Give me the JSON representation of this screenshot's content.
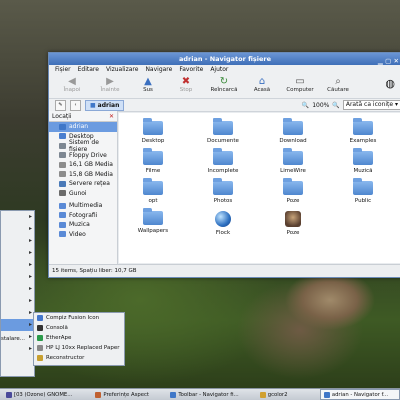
{
  "window": {
    "title": "adrian - Navigator fișiere",
    "menubar": [
      "Fișier",
      "Editare",
      "Vizualizare",
      "Navigare",
      "Favorite",
      "Ajutor"
    ],
    "toolbar": [
      {
        "label": "Înapoi",
        "icon": "back-arrow-icon",
        "enabled": false
      },
      {
        "label": "Înainte",
        "icon": "forward-arrow-icon",
        "enabled": false
      },
      {
        "label": "Sus",
        "icon": "up-arrow-icon",
        "enabled": true
      },
      {
        "label": "Stop",
        "icon": "stop-icon",
        "enabled": false
      },
      {
        "label": "Reîncarcă",
        "icon": "reload-icon",
        "enabled": true
      },
      {
        "label": "Acasă",
        "icon": "home-icon",
        "enabled": true
      },
      {
        "label": "Computer",
        "icon": "computer-icon",
        "enabled": true
      },
      {
        "label": "Căutare",
        "icon": "search-icon",
        "enabled": true
      }
    ],
    "location": {
      "crumb": "adrian",
      "zoom": "100%",
      "view": "Arată ca iconițe"
    },
    "sidebar": {
      "header": "Locații",
      "items": [
        {
          "label": "adrian",
          "color": "#3f77c8",
          "selected": true
        },
        {
          "label": "Desktop",
          "color": "#4b7fcf"
        },
        {
          "label": "Sistem de fișiere",
          "color": "#7d8792"
        },
        {
          "label": "Floppy Drive",
          "color": "#7d8792"
        },
        {
          "label": "16,1 GB Media",
          "color": "#8c8c8c"
        },
        {
          "label": "15,8 GB Media",
          "color": "#8c8c8c"
        },
        {
          "label": "Servere rețea",
          "color": "#4a7ab8"
        },
        {
          "label": "Gunoi",
          "color": "#6b6b6b"
        },
        {
          "label": "Multimedia",
          "color": "#5a8ad6"
        },
        {
          "label": "Fotografii",
          "color": "#5a8ad6"
        },
        {
          "label": "Muzica",
          "color": "#5a8ad6"
        },
        {
          "label": "Video",
          "color": "#5a8ad6"
        }
      ]
    },
    "files": [
      {
        "label": "Desktop",
        "kind": "folder"
      },
      {
        "label": "Documente",
        "kind": "folder"
      },
      {
        "label": "Download",
        "kind": "folder"
      },
      {
        "label": "Examples",
        "kind": "folder"
      },
      {
        "label": "Filme",
        "kind": "folder"
      },
      {
        "label": "Incomplete",
        "kind": "folder"
      },
      {
        "label": "LimeWire",
        "kind": "folder"
      },
      {
        "label": "Muzică",
        "kind": "folder"
      },
      {
        "label": "opt",
        "kind": "folder"
      },
      {
        "label": "Photos",
        "kind": "folder"
      },
      {
        "label": "Poze",
        "kind": "folder"
      },
      {
        "label": "Public",
        "kind": "folder"
      },
      {
        "label": "Wallpapers",
        "kind": "folder"
      },
      {
        "label": "Flock",
        "kind": "globe"
      },
      {
        "label": "Poze",
        "kind": "photo"
      }
    ],
    "status": "15 items, Spațiu liber: 10,7 GB"
  },
  "menu": {
    "label": "stalare...",
    "submenu": [
      {
        "label": "Compiz Fusion Icon",
        "color": "#4477cc"
      },
      {
        "label": "Consolă",
        "color": "#333333"
      },
      {
        "label": "EtherApe",
        "color": "#2a9a4a"
      },
      {
        "label": "HP LJ 10xx Replaced Paper",
        "color": "#888888"
      },
      {
        "label": "Reconstructor",
        "color": "#c8a030"
      }
    ]
  },
  "taskbar": [
    {
      "label": "[03 (Ozone) GNOME...",
      "color": "#4a4a9a",
      "active": false
    },
    {
      "label": "Preferințe Aspect",
      "color": "#c06030",
      "active": false
    },
    {
      "label": "Toolbar - Navigator fi...",
      "color": "#3f77c8",
      "active": false
    },
    {
      "label": "gcolor2",
      "color": "#d0a030",
      "active": false
    },
    {
      "label": "adrian - Navigator f...",
      "color": "#3f77c8",
      "active": true
    }
  ]
}
